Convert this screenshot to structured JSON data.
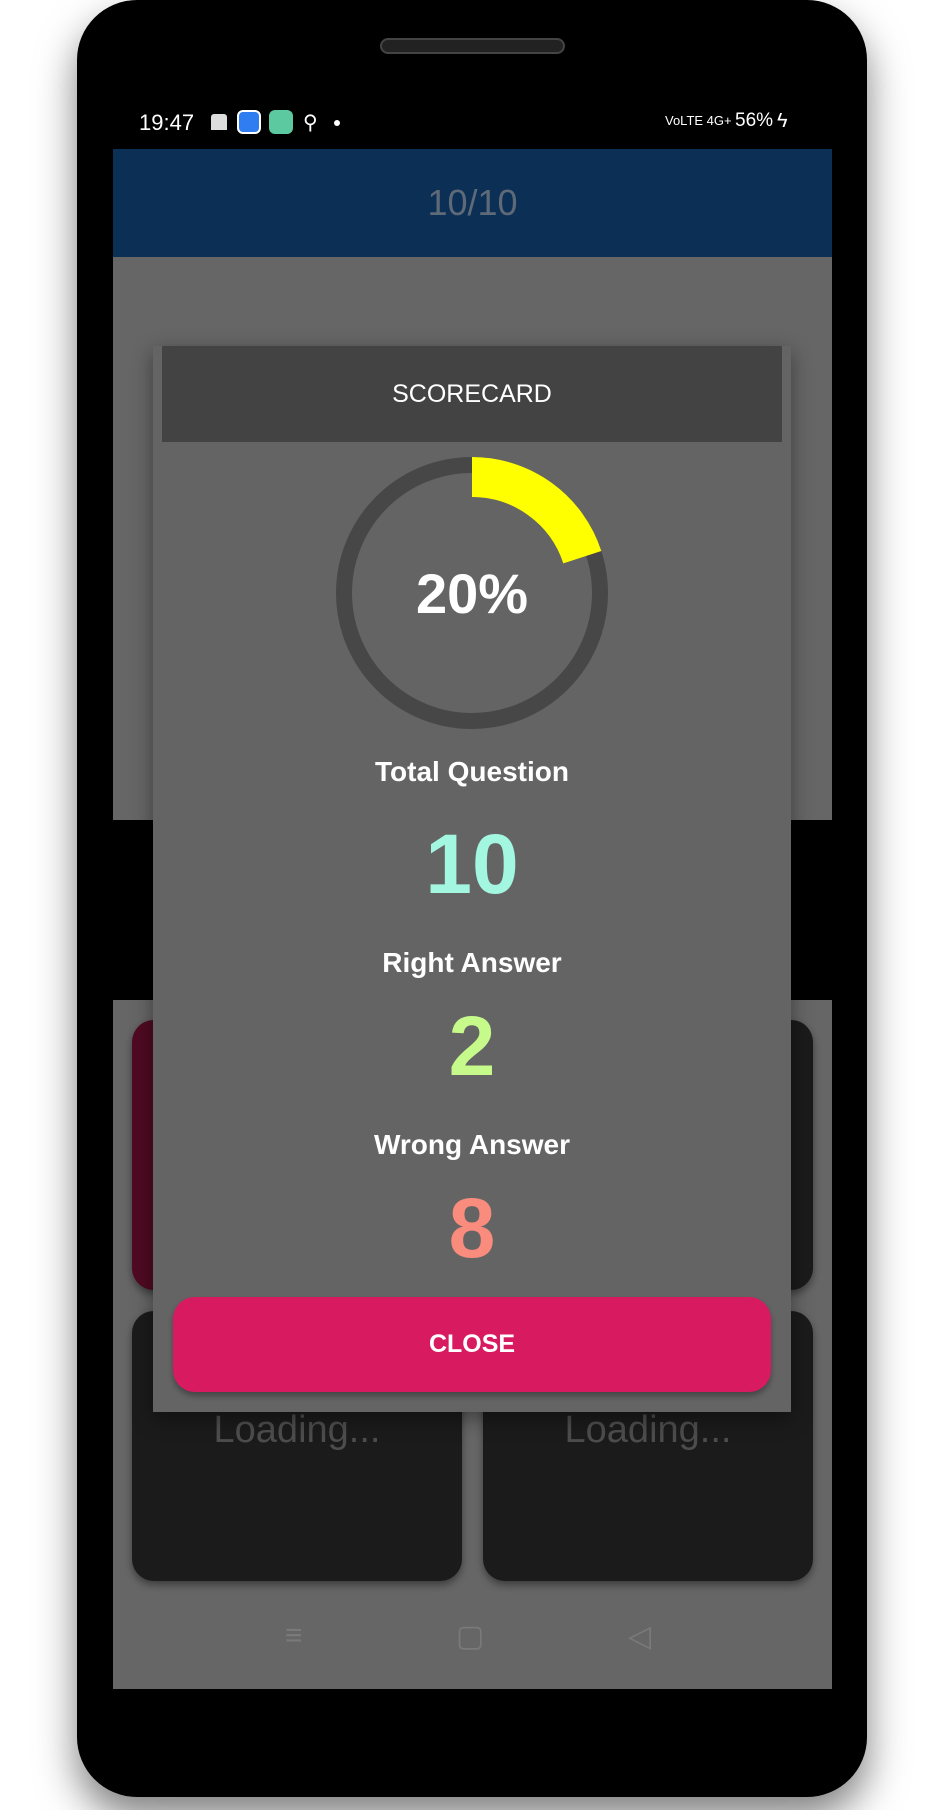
{
  "status_bar": {
    "time": "19:47",
    "network": "VoLTE 4G+",
    "battery": "56%"
  },
  "app_bar": {
    "title": "10/10"
  },
  "cards": [
    {
      "label": ""
    },
    {
      "label": ""
    },
    {
      "label": "Loading..."
    },
    {
      "label": "Loading..."
    }
  ],
  "dialog": {
    "title": "SCORECARD",
    "progress": {
      "percent": 20,
      "label": "20%",
      "track_color": "#474747",
      "fill_color": "#ffff00"
    },
    "total_label": "Total Question",
    "total_value": "10",
    "total_color": "#a3f7e1",
    "right_label": "Right Answer",
    "right_value": "2",
    "right_color": "#c6fa8a",
    "wrong_label": "Wrong Answer",
    "wrong_value": "8",
    "wrong_color": "#fa8c7e",
    "close_label": "CLOSE"
  },
  "nav": {
    "menu_icon": "≡",
    "home_icon": "▢",
    "back_icon": "◁"
  }
}
